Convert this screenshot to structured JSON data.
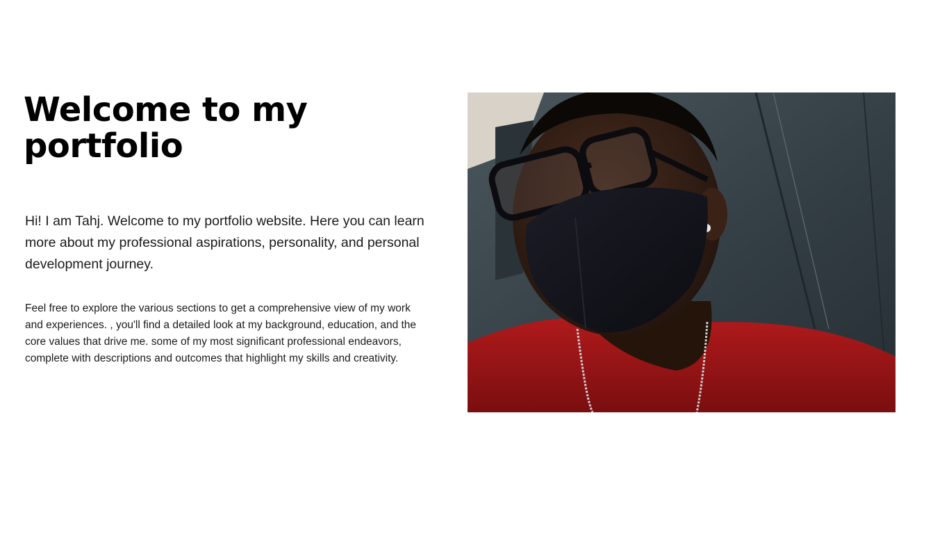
{
  "hero": {
    "title": "Welcome to my portfolio",
    "intro": "Hi! I am Tahj. Welcome to my portfolio website. Here you can learn more about my professional aspirations, personality, and personal development journey.",
    "details": "Feel free to explore the various sections to get a comprehensive view of my work and experiences. , you'll find a detailed look at my background, education, and the core values that drive me.  some of my most significant professional endeavors, complete with descriptions and outcomes that highlight my skills and creativity."
  },
  "photo": {
    "subject": "portrait-photo",
    "colors": {
      "background_wall": "#3a474d",
      "shirt": "#9c1416",
      "mask": "#14141c",
      "skin": "#3a2217"
    }
  }
}
